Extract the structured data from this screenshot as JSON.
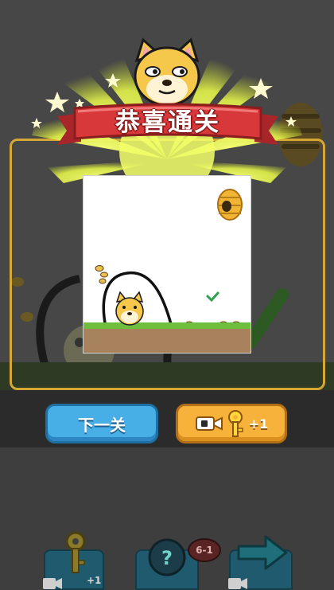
{
  "popup": {
    "title": "恭喜通关"
  },
  "buttons": {
    "next_level_label": "下一关",
    "watch_video_reward": "+1"
  },
  "toolbar": {
    "key_reward": "+1",
    "hint_cost": "6-1"
  },
  "colors": {
    "panel_border": "#d6a734",
    "ribbon_red": "#d9383a",
    "next_button": "#47aee6",
    "video_button": "#f6b23a"
  }
}
